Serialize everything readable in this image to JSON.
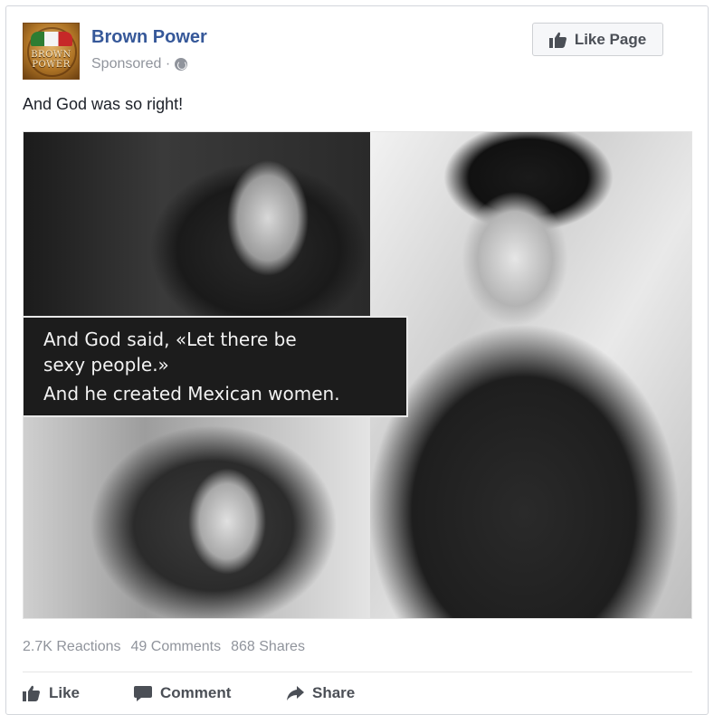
{
  "post": {
    "page_name": "Brown Power",
    "sponsored_label": "Sponsored ·",
    "like_page_label": "Like Page",
    "text": "And God was so right!",
    "avatar_text_line1": "BROWN",
    "avatar_text_line2": "POWER"
  },
  "image": {
    "caption_line1": "And God said, «Let there be",
    "caption_line2": "sexy people.»",
    "caption_line3": "And he created Mexican women."
  },
  "stats": {
    "reactions": "2.7K Reactions",
    "comments": "49 Comments",
    "shares": "868 Shares"
  },
  "actions": {
    "like": "Like",
    "comment": "Comment",
    "share": "Share"
  },
  "icons": {
    "avatar": "brown-power-logo",
    "visibility": "globe-icon",
    "like_page": "thumbs-up-icon",
    "like": "thumbs-up-icon",
    "comment": "speech-bubble-icon",
    "share": "share-arrow-icon"
  },
  "colors": {
    "page_name": "#365899",
    "muted": "#90949c",
    "action_text": "#4b4f56"
  }
}
